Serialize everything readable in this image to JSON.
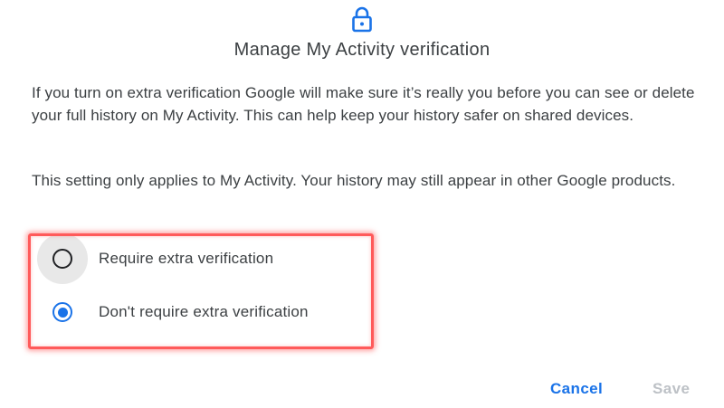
{
  "dialog": {
    "icon": "lock-icon",
    "title": "Manage My Activity verification",
    "paragraph1": "If you turn on extra verification Google will make sure it’s really you before you can see or delete your full history on My Activity. This can help keep your history safer on shared devices.",
    "paragraph2": "This setting only applies to My Activity. Your history may still appear in other Google products.",
    "options": [
      {
        "label": "Require extra verification",
        "selected": false
      },
      {
        "label": "Don't require extra verification",
        "selected": true
      }
    ],
    "buttons": {
      "cancel_label": "Cancel",
      "save_label": "Save"
    }
  },
  "colors": {
    "accent": "#1a73e8",
    "highlight": "#ff5a5a",
    "disabled": "#bdc1c6",
    "text": "#3c4043"
  }
}
